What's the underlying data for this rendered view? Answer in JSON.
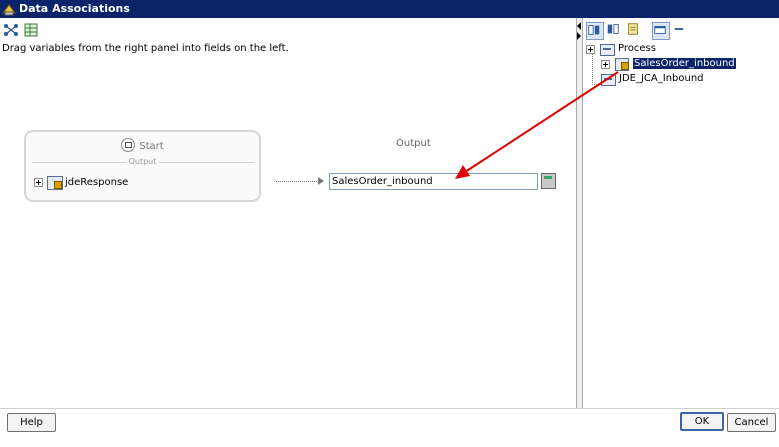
{
  "window": {
    "title": "Data Associations",
    "hint": "Drag variables from the right panel into fields on the left."
  },
  "toolbar_left": {
    "icons": [
      "map-icon",
      "spreadsheet-icon"
    ]
  },
  "left": {
    "start_label": "Start",
    "output_section": "Output",
    "variable": "jdeResponse",
    "output_header": "Output",
    "target_value": "SalesOrder_inbound"
  },
  "right": {
    "toolbar_icons": [
      "sort-up-icon",
      "sort-down-icon",
      "list-icon",
      "window-icon",
      "minus-icon"
    ],
    "tree": {
      "root": "Process",
      "child": "SalesOrder_inbound",
      "sibling": "JDE_JCA_Inbound"
    }
  },
  "buttons": {
    "help": "Help",
    "ok": "OK",
    "cancel": "Cancel"
  },
  "colors": {
    "titlebar": "#0a246a",
    "annotation_arrow": "#e00000",
    "selection": "#0a246a"
  }
}
